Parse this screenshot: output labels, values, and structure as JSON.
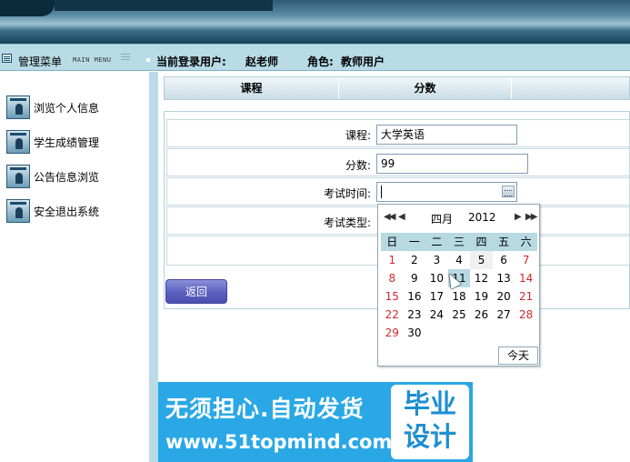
{
  "header": {
    "menu_title": "管理菜单",
    "menu_subtitle": "MAIN MENU",
    "login_label": "当前登录用户:",
    "login_user": "赵老师",
    "role_label": "角色:",
    "role_value": "教师用户"
  },
  "sidebar": {
    "items": [
      {
        "label": "浏览个人信息",
        "icon": "user-window-icon"
      },
      {
        "label": "学生成绩管理",
        "icon": "user-window-icon"
      },
      {
        "label": "公告信息浏览",
        "icon": "user-window-icon"
      },
      {
        "label": "安全退出系统",
        "icon": "user-window-icon"
      }
    ]
  },
  "table": {
    "columns": [
      "课程",
      "分数"
    ]
  },
  "form": {
    "course_label": "课程:",
    "course_value": "大学英语",
    "score_label": "分数:",
    "score_value": "99",
    "exam_time_label": "考试时间:",
    "exam_time_value": "",
    "exam_type_label": "考试类型:",
    "back_label": "返回"
  },
  "calendar": {
    "prev_year": "◀◀",
    "prev_month": "◀",
    "month": "四月",
    "year": "2012",
    "next_month": "▶",
    "next_year": "▶▶",
    "weekdays": [
      "日",
      "一",
      "二",
      "三",
      "四",
      "五",
      "六"
    ],
    "weeks": [
      [
        "1",
        "2",
        "3",
        "4",
        "5",
        "6",
        "7"
      ],
      [
        "8",
        "9",
        "10",
        "11",
        "12",
        "13",
        "14"
      ],
      [
        "15",
        "16",
        "17",
        "18",
        "19",
        "20",
        "21"
      ],
      [
        "22",
        "23",
        "24",
        "25",
        "26",
        "27",
        "28"
      ],
      [
        "29",
        "30",
        "",
        "",
        "",
        "",
        ""
      ]
    ],
    "today_day": "11",
    "hover_day": "5",
    "today_button": "今天",
    "weekend_color": "#d0282e",
    "highlight_color": "#b6d9e2"
  },
  "ad": {
    "line1": "无须担心.自动发货",
    "line2": "www.51topmind.com",
    "badge_line1": "毕业",
    "badge_line2": "设计"
  }
}
